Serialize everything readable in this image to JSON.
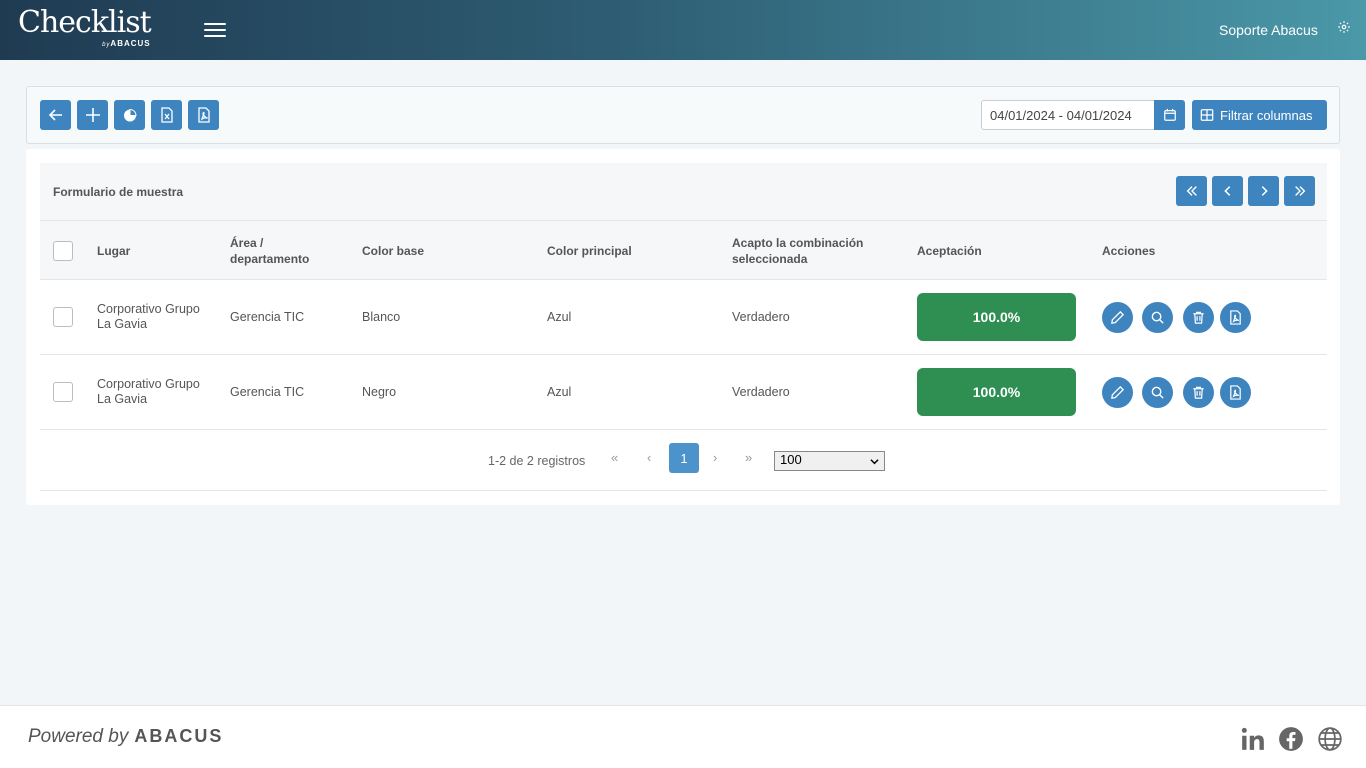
{
  "header": {
    "logo_main": "Checklist",
    "logo_by": "by",
    "logo_brand": "ABACUS",
    "user_name": "Soporte Abacus"
  },
  "toolbar": {
    "date_range": "04/01/2024 - 04/01/2024",
    "filter_label": "Filtrar columnas",
    "icons": [
      "arrow-left-icon",
      "plus-icon",
      "pie-chart-icon",
      "excel-file-icon",
      "pdf-file-icon"
    ]
  },
  "table": {
    "title": "Formulario de muestra",
    "headers": {
      "lugar": "Lugar",
      "area_1": "Área /",
      "area_2": "departamento",
      "color_base": "Color base",
      "color_principal": "Color principal",
      "acepto_1": "Acapto la combinación",
      "acepto_2": "seleccionada",
      "aceptacion": "Aceptación",
      "acciones": "Acciones"
    },
    "rows": [
      {
        "lugar_1": "Corporativo Grupo",
        "lugar_2": "La Gavia",
        "area": "Gerencia TIC",
        "color_base": "Blanco",
        "color_principal": "Azul",
        "acepto": "Verdadero",
        "aceptacion": "100.0%"
      },
      {
        "lugar_1": "Corporativo Grupo",
        "lugar_2": "La Gavia",
        "area": "Gerencia TIC",
        "color_base": "Negro",
        "color_principal": "Azul",
        "acepto": "Verdadero",
        "aceptacion": "100.0%"
      }
    ]
  },
  "pagination": {
    "records": "1-2 de 2 registros",
    "first": "«",
    "prev": "‹",
    "current": "1",
    "next": "›",
    "last": "»",
    "page_size": "100"
  },
  "footer": {
    "powered": "Powered by",
    "brand": "ABACUS"
  },
  "colors": {
    "primary": "#3e85c0",
    "success": "#2f8f52"
  }
}
